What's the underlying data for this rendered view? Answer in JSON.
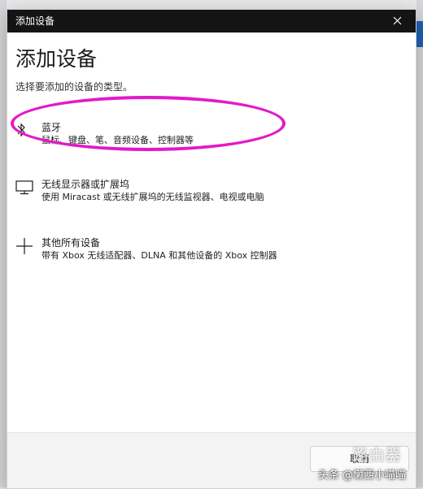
{
  "window": {
    "title": "添加设备"
  },
  "header": {
    "title": "添加设备",
    "subtitle": "选择要添加的设备的类型。"
  },
  "options": [
    {
      "title": "蓝牙",
      "description": "鼠标、键盘、笔、音频设备、控制器等",
      "icon": "bluetooth-icon"
    },
    {
      "title": "无线显示器或扩展坞",
      "description": "使用 Miracast 或无线扩展坞的无线监视器、电视或电脑",
      "icon": "monitor-icon"
    },
    {
      "title": "其他所有设备",
      "description": "带有 Xbox 无线适配器、DLNA 和其他设备的 Xbox 控制器",
      "icon": "plus-icon"
    }
  ],
  "footer": {
    "cancel_label": "取消"
  },
  "watermark": {
    "text": "头条 @懒西小喵喵",
    "logo": "路由器"
  },
  "colors": {
    "annotation": "#e21ac8",
    "titlebar": "#141414",
    "accent": "#1e63b3"
  }
}
